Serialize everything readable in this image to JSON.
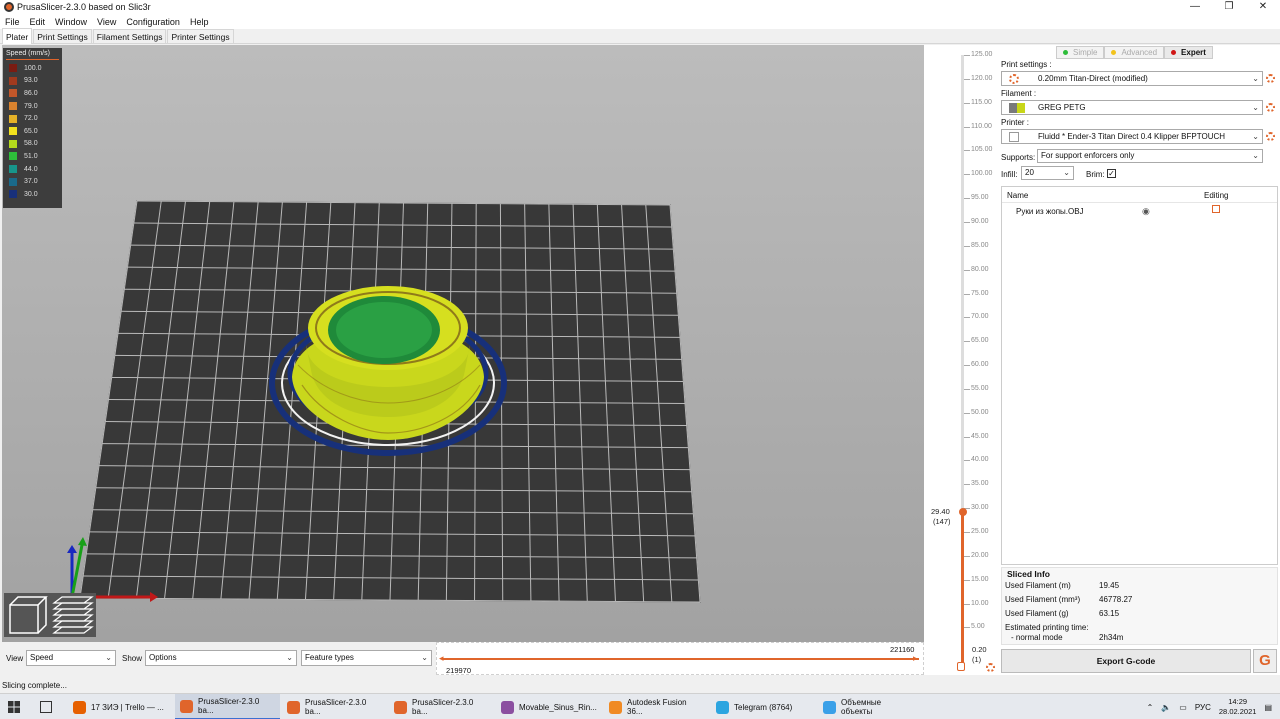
{
  "window": {
    "title": "PrusaSlicer-2.3.0 based on Slic3r",
    "controls": [
      "—",
      "❐",
      "✕"
    ]
  },
  "menu": [
    "File",
    "Edit",
    "Window",
    "View",
    "Configuration",
    "Help"
  ],
  "tabs": [
    "Plater",
    "Print Settings",
    "Filament Settings",
    "Printer Settings"
  ],
  "legend": {
    "title": "Speed (mm/s)",
    "items": [
      {
        "value": "100.0",
        "color": "#7a1c12"
      },
      {
        "value": "93.0",
        "color": "#a13a1e"
      },
      {
        "value": "86.0",
        "color": "#c2572a"
      },
      {
        "value": "79.0",
        "color": "#d9822e"
      },
      {
        "value": "72.0",
        "color": "#e5b127"
      },
      {
        "value": "65.0",
        "color": "#f2e11d"
      },
      {
        "value": "58.0",
        "color": "#b4d91c"
      },
      {
        "value": "51.0",
        "color": "#2ebd3a"
      },
      {
        "value": "44.0",
        "color": "#17958a"
      },
      {
        "value": "37.0",
        "color": "#1a6a8a"
      },
      {
        "value": "30.0",
        "color": "#18307a"
      }
    ]
  },
  "layer_slider": {
    "ticks": [
      "125.00",
      "120.00",
      "115.00",
      "110.00",
      "105.00",
      "100.00",
      "95.00",
      "90.00",
      "85.00",
      "80.00",
      "75.00",
      "70.00",
      "65.00",
      "60.00",
      "55.00",
      "50.00",
      "45.00",
      "40.00",
      "35.00",
      "30.00",
      "25.00",
      "20.00",
      "15.00",
      "10.00",
      "5.00"
    ],
    "upper_value": "29.40",
    "upper_layer": "(147)",
    "lower_value": "0.20",
    "lower_layer": "(1)"
  },
  "modes": [
    {
      "label": "Simple",
      "color": "#2ebd3a",
      "state": "dim"
    },
    {
      "label": "Advanced",
      "color": "#f2c31d",
      "state": "dim"
    },
    {
      "label": "Expert",
      "color": "#d01616",
      "state": "active"
    }
  ],
  "print_settings": {
    "label": "Print settings :",
    "value": "0.20mm Titan-Direct (modified)"
  },
  "filament": {
    "label": "Filament :",
    "value": "GREG PETG",
    "color": "#c8d618"
  },
  "printer": {
    "label": "Printer :",
    "value": "Fluidd * Ender-3 Titan Direct 0.4 Klipper BFPTOUCH"
  },
  "supports": {
    "label": "Supports:",
    "value": "For support enforcers only"
  },
  "infill": {
    "label": "Infill:",
    "value": "20"
  },
  "brim": {
    "label": "Brim:",
    "checked": true,
    "mark": "✓"
  },
  "object_list": {
    "col_name": "Name",
    "col_editing": "Editing",
    "rows": [
      {
        "name": "Руки из жопы.OBJ"
      }
    ]
  },
  "sliced_info": {
    "title": "Sliced Info",
    "rows": [
      {
        "label": "Used Filament (m)",
        "value": "19.45"
      },
      {
        "label": "Used Filament (mm³)",
        "value": "46778.27"
      },
      {
        "label": "Used Filament (g)",
        "value": "63.15"
      },
      {
        "label": "Estimated printing time:",
        "value": ""
      },
      {
        "label": "- normal mode",
        "value": "2h34m"
      }
    ]
  },
  "export_button": "Export G-code",
  "bottom": {
    "view_label": "View",
    "view_value": "Speed",
    "show_label": "Show",
    "show_value": "Options",
    "feature_value": "Feature types",
    "hslider_max": "221160",
    "hslider_min": "219970"
  },
  "status": "Slicing complete...",
  "taskbar": {
    "items": [
      {
        "label": "17 ЗИЭ | Trello — ...",
        "color": "#e66000",
        "active": false
      },
      {
        "label": "PrusaSlicer-2.3.0 ba...",
        "color": "#e0652b",
        "active": true
      },
      {
        "label": "PrusaSlicer-2.3.0 ba...",
        "color": "#e0652b",
        "active": false
      },
      {
        "label": "PrusaSlicer-2.3.0 ba...",
        "color": "#e0652b",
        "active": false
      },
      {
        "label": "Movable_Sinus_Rin...",
        "color": "#8b4fa0",
        "active": false
      },
      {
        "label": "Autodesk Fusion 36...",
        "color": "#f08a24",
        "active": false
      },
      {
        "label": "Telegram (8764)",
        "color": "#2ca5e0",
        "active": false
      },
      {
        "label": "Объемные объекты",
        "color": "#3aa0e8",
        "active": false
      }
    ],
    "lang": "РУС",
    "time": "14:29",
    "date": "28.02.2021"
  }
}
